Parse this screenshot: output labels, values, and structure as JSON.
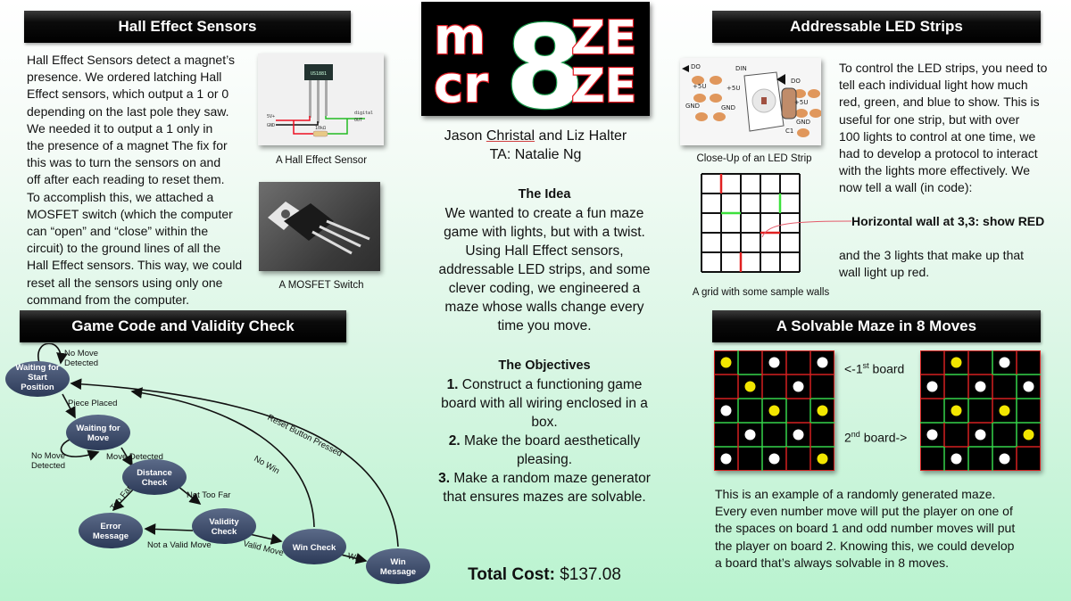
{
  "hall": {
    "title": "Hall Effect Sensors",
    "lines": [
      "Hall Effect Sensors detect a magnet’s",
      "presence. We ordered latching Hall",
      "Effect sensors, which output a 1 or 0",
      "depending on the last pole they saw.",
      "We needed it to output a 1 only in",
      "the presence of a magnet The fix for",
      "this was to turn the sensors on and",
      "off after each reading to reset them.",
      "To accomplish this, we attached a",
      "MOSFET switch (which the computer",
      "can “open” and “close” within the",
      "circuit) to the ground lines of all the",
      "Hall Effect sensors. This way, we could",
      "reset all the sensors using only one",
      "command from the computer."
    ],
    "sensor_caption": "A Hall Effect Sensor",
    "sensor_chip_label": "US1881",
    "sensor_pin_5v": "5V+",
    "sensor_pin_gnd": "GND",
    "sensor_resistor": "10kΩ",
    "sensor_out_1": "digital",
    "sensor_out_2": "OUT",
    "mosfet_caption": "A MOSFET Switch"
  },
  "game": {
    "title": "Game Code and Validity Check",
    "nodes": {
      "start": [
        "Waiting for",
        "Start",
        "Position"
      ],
      "move": [
        "Waiting for",
        "Move"
      ],
      "distance": [
        "Distance",
        "Check"
      ],
      "error": [
        "Error",
        "Message"
      ],
      "validity": [
        "Validity",
        "Check"
      ],
      "wincheck": [
        "Win Check"
      ],
      "winmsg": [
        "Win",
        "Message"
      ]
    },
    "edges": {
      "no_move_1a": "No Move",
      "no_move_1b": "Detected",
      "piece_placed": "Piece Placed",
      "no_move_2a": "No Move",
      "no_move_2b": "Detected",
      "move_detected": "Move Detected",
      "too_far": "Too Far",
      "not_too_far": "Not Too Far",
      "not_valid": "Not a Valid Move",
      "valid_move": "Valid Move",
      "no_win": "No Win",
      "win": "Win",
      "reset": "Reset Button Pressed"
    }
  },
  "logo": {
    "line1_left": "m",
    "line2_left": "cr",
    "big_digit": "8",
    "line1_right": "ZE",
    "line2_right": "ZE",
    "red": "#e31b23",
    "green": "#1a9a4a"
  },
  "center": {
    "authors_pre": "Jason ",
    "authors_underlined": "Christal",
    "authors_post": " and Liz Halter",
    "ta": "TA: Natalie Ng",
    "idea_title": "The Idea",
    "idea_lines": [
      "We wanted to create a fun maze",
      "game with lights, but with a twist.",
      "Using Hall Effect sensors,",
      "addressable LED strips, and some",
      "clever coding, we engineered a",
      "maze whose walls change every",
      "time you move."
    ],
    "objectives_title": "The Objectives",
    "objectives": [
      {
        "num": "1.",
        "lines": [
          " Construct a functioning game",
          "board with all wiring enclosed in a",
          "box."
        ]
      },
      {
        "num": "2.",
        "lines": [
          " Make the board aesthetically",
          "pleasing."
        ]
      },
      {
        "num": "3.",
        "lines": [
          " Make a random maze generator",
          "that ensures mazes are solvable."
        ]
      }
    ],
    "cost_label": "Total Cost:",
    "cost_value": " $137.08"
  },
  "led": {
    "title": "Addressable LED Strips",
    "strip_caption": "Close-Up of an LED Strip",
    "strip_labels": [
      "DO",
      "DIN",
      "+5U",
      "+5U",
      "GND",
      "GND",
      "DO",
      "+5U",
      "GND",
      "C1"
    ],
    "lines": [
      "To control the LED strips, you need to",
      "tell each individual light how much",
      "red, green, and blue to show. This is",
      "useful for one strip, but with over",
      "100 lights to control at one time, we",
      "had to develop a protocol to interact",
      "with the lights more effectively. We",
      "now tell a wall (in code):"
    ],
    "callout": "Horizontal wall at 3,3: show RED",
    "after_lines": [
      "and the 3 lights that make up that",
      "wall light up red."
    ],
    "grid_caption": "A grid with some sample walls"
  },
  "solvable": {
    "title": "A Solvable Maze in 8 Moves",
    "board1_pre": "<-1",
    "board1_sup": "st",
    "board1_post": " board",
    "board2_pre": "2",
    "board2_sup": "nd",
    "board2_post": " board->",
    "lines": [
      "This is an example of a randomly generated maze.",
      "Every even number move will put the player on one of",
      "the spaces on board 1 and odd number moves will put",
      "the player on board 2.  Knowing this, we could develop",
      "a board that’s always solvable in 8 moves."
    ],
    "colors": {
      "wall": "#d42020",
      "open": "#35d44a",
      "yellow": "#f2e600",
      "white": "#ffffff"
    },
    "board1_dots": [
      [
        "Y",
        "",
        "W",
        "",
        "W"
      ],
      [
        "",
        "Y",
        "",
        "W",
        ""
      ],
      [
        "W",
        "",
        "Y",
        "",
        "Y"
      ],
      [
        "",
        "W",
        "",
        "W",
        ""
      ],
      [
        "W",
        "",
        "W",
        "",
        "Y"
      ]
    ],
    "board2_dots": [
      [
        "",
        "Y",
        "",
        "W",
        ""
      ],
      [
        "W",
        "",
        "W",
        "",
        "W"
      ],
      [
        "",
        "Y",
        "",
        "Y",
        ""
      ],
      [
        "W",
        "",
        "W",
        "",
        "Y"
      ],
      [
        "",
        "W",
        "",
        "W",
        ""
      ]
    ]
  }
}
